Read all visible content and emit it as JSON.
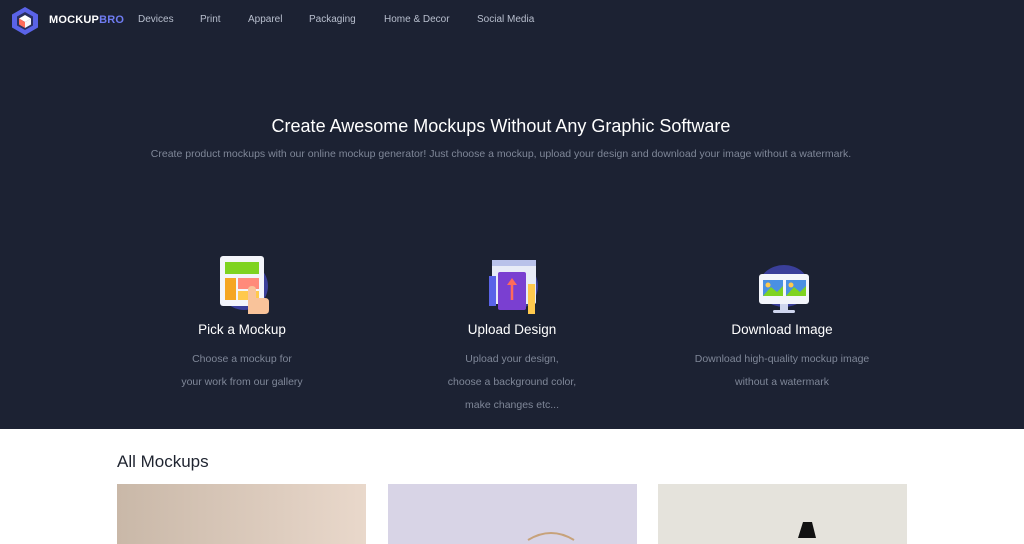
{
  "brand": {
    "name_main": "MOCKUP",
    "name_accent": "BRO"
  },
  "nav": {
    "items": [
      {
        "label": "Devices"
      },
      {
        "label": "Print"
      },
      {
        "label": "Apparel"
      },
      {
        "label": "Packaging"
      },
      {
        "label": "Home & Decor"
      },
      {
        "label": "Social Media"
      }
    ]
  },
  "hero": {
    "headline": "Create Awesome Mockups Without Any Graphic Software",
    "subline": "Create product mockups with our online mockup generator! Just choose a mockup, upload your design and download your image without a watermark."
  },
  "steps": [
    {
      "title": "Pick a Mockup",
      "icon": "pick-mockup-icon",
      "lines": [
        "Choose a mockup for",
        "your work from our gallery"
      ]
    },
    {
      "title": "Upload Design",
      "icon": "upload-design-icon",
      "lines": [
        "Upload your design,",
        "choose a background color,",
        "make changes etc..."
      ]
    },
    {
      "title": "Download Image",
      "icon": "download-image-icon",
      "lines": [
        "Download high-quality mockup image",
        "without a watermark"
      ]
    }
  ],
  "gallery": {
    "title": "All Mockups"
  },
  "colors": {
    "hero_bg": "#1c2233",
    "accent": "#6f7cf2",
    "text_muted": "#7f8798",
    "nav_text": "#b8bfce"
  }
}
